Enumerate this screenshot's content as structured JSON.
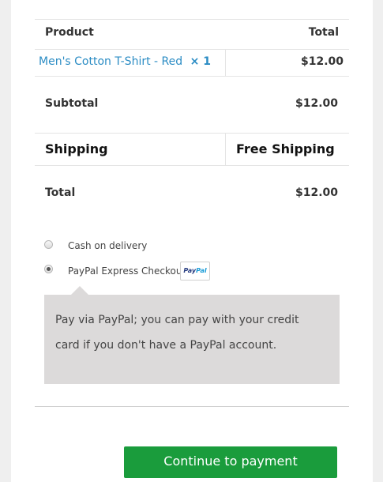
{
  "order_table": {
    "headers": {
      "product": "Product",
      "total": "Total"
    },
    "items": [
      {
        "name": "Men's Cotton T-Shirt - Red",
        "quantity": "× 1",
        "total": "$12.00"
      }
    ],
    "subtotal": {
      "label": "Subtotal",
      "value": "$12.00"
    },
    "shipping": {
      "label": "Shipping",
      "value": "Free Shipping"
    },
    "total": {
      "label": "Total",
      "value": "$12.00"
    }
  },
  "payment_methods": [
    {
      "label": "Cash on delivery",
      "selected": false
    },
    {
      "label": "PayPal Express Checkout",
      "selected": true,
      "logo_text_dark": "Pay",
      "logo_text_light": "Pal"
    }
  ],
  "payment_description": "Pay via PayPal; you can pay with your credit card if you don't have a PayPal account.",
  "submit_label": "Continue to payment",
  "colors": {
    "link": "#2b8cc4",
    "button": "#1a9c3c",
    "description_box": "#dcdada"
  }
}
